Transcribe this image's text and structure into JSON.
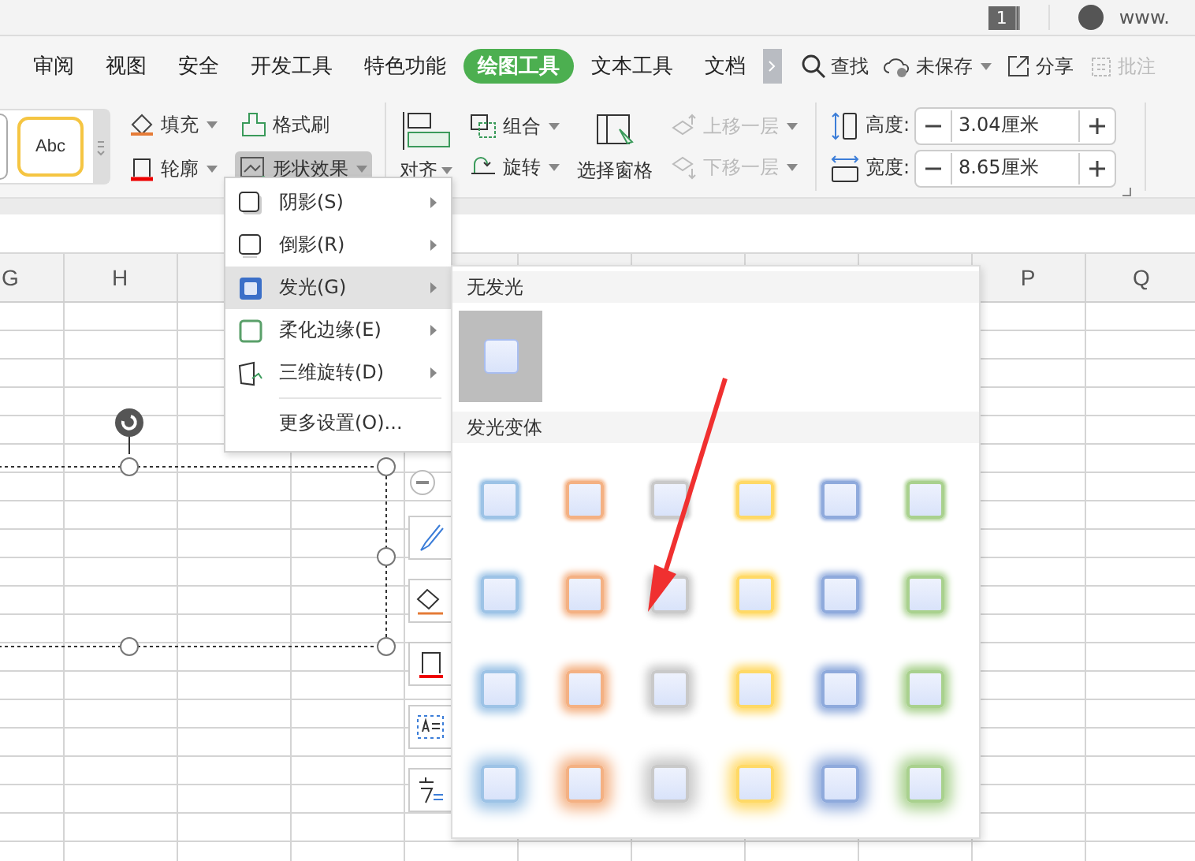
{
  "title_bar": {
    "badge": "1",
    "site": "www."
  },
  "tabs": [
    {
      "label": "审阅",
      "selected": false
    },
    {
      "label": "视图",
      "selected": false
    },
    {
      "label": "安全",
      "selected": false
    },
    {
      "label": "开发工具",
      "selected": false
    },
    {
      "label": "特色功能",
      "selected": false
    },
    {
      "label": "绘图工具",
      "selected": true
    },
    {
      "label": "文本工具",
      "selected": false
    },
    {
      "label": "文档",
      "selected": false
    }
  ],
  "quick_actions": [
    {
      "label": "查找",
      "kind": "search",
      "dropdown": false,
      "disabled": false
    },
    {
      "label": "未保存",
      "kind": "cloud",
      "dropdown": true,
      "disabled": false
    },
    {
      "label": "分享",
      "kind": "share",
      "dropdown": false,
      "disabled": false
    },
    {
      "label": "批注",
      "kind": "comment",
      "dropdown": false,
      "disabled": true
    }
  ],
  "style_gallery": {
    "sample": "Abc"
  },
  "format_buttons": [
    {
      "label": "填充",
      "kind": "fill",
      "dropdown": true,
      "active": false
    },
    {
      "label": "格式刷",
      "kind": "brush",
      "dropdown": false,
      "active": false
    },
    {
      "label": "轮廓",
      "kind": "outline",
      "dropdown": true,
      "active": false
    },
    {
      "label": "形状效果",
      "kind": "effects",
      "dropdown": true,
      "active": true
    }
  ],
  "align_button": {
    "label": "对齐"
  },
  "group_buttons": [
    {
      "label": "组合",
      "kind": "group"
    },
    {
      "label": "旋转",
      "kind": "rotate"
    }
  ],
  "selection_pane": {
    "label": "选择窗格"
  },
  "layer_buttons": [
    {
      "label": "上移一层",
      "kind": "up",
      "disabled": true
    },
    {
      "label": "下移一层",
      "kind": "down",
      "disabled": true
    }
  ],
  "size_fields": [
    {
      "label": "高度:",
      "value": "3.04厘米",
      "kind": "height"
    },
    {
      "label": "宽度:",
      "value": "8.65厘米",
      "kind": "width"
    }
  ],
  "columns": [
    "G",
    "H",
    "P",
    "Q"
  ],
  "effects_menu": [
    {
      "label": "阴影(S)",
      "kind": "shadow",
      "submenu": true,
      "selected": false
    },
    {
      "label": "倒影(R)",
      "kind": "reflection",
      "submenu": true,
      "selected": false
    },
    {
      "label": "发光(G)",
      "kind": "glow",
      "submenu": true,
      "selected": true
    },
    {
      "label": "柔化边缘(E)",
      "kind": "soft",
      "submenu": true,
      "selected": false
    },
    {
      "label": "三维旋转(D)",
      "kind": "rotate3d",
      "submenu": true,
      "selected": false
    },
    {
      "label": "更多设置(O)...",
      "kind": "more",
      "submenu": false,
      "selected": false
    }
  ],
  "glow_submenu": {
    "none_title": "无发光",
    "variants_title": "发光变体",
    "rows": [
      {
        "kind": "small",
        "options": [
          {
            "color": "#9dc3e6"
          },
          {
            "color": "#f4b183"
          },
          {
            "color": "#c9c9c9"
          },
          {
            "color": "#ffd966"
          },
          {
            "color": "#8faadc"
          },
          {
            "color": "#a9d18e"
          }
        ]
      },
      {
        "kind": "medium",
        "options": [
          {
            "color": "#9dc3e6"
          },
          {
            "color": "#f4b183"
          },
          {
            "color": "#c9c9c9"
          },
          {
            "color": "#ffd966"
          },
          {
            "color": "#8faadc"
          },
          {
            "color": "#a9d18e"
          }
        ]
      },
      {
        "kind": "large",
        "options": [
          {
            "color": "#9dc3e6"
          },
          {
            "color": "#f4b183"
          },
          {
            "color": "#c9c9c9"
          },
          {
            "color": "#ffd966"
          },
          {
            "color": "#8faadc"
          },
          {
            "color": "#a9d18e"
          }
        ]
      },
      {
        "kind": "xlarge",
        "options": [
          {
            "color": "#9dc3e6"
          },
          {
            "color": "#f4b183"
          },
          {
            "color": "#c9c9c9"
          },
          {
            "color": "#ffd966"
          },
          {
            "color": "#8faadc"
          },
          {
            "color": "#a9d18e"
          }
        ]
      }
    ]
  }
}
